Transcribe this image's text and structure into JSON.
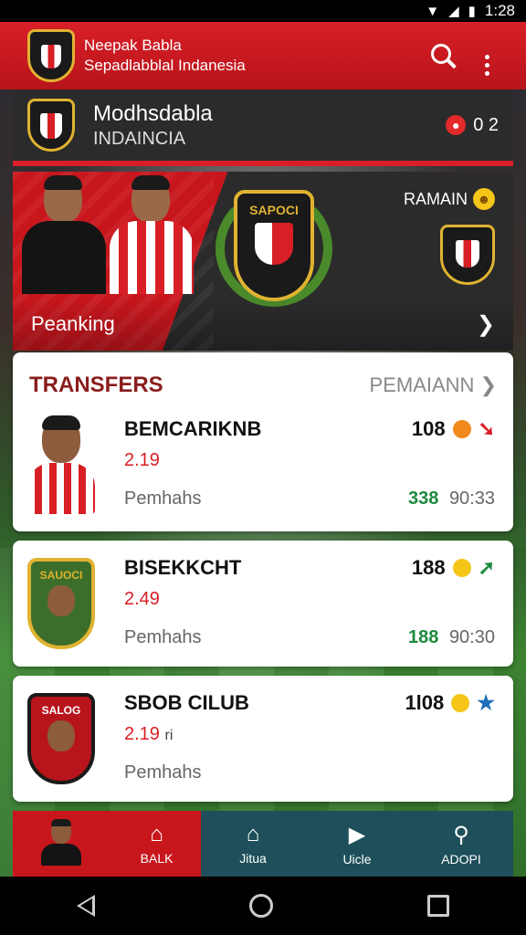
{
  "status_bar": {
    "time": "1:28",
    "icons": [
      "wifi-icon",
      "signal-icon",
      "battery-icon"
    ]
  },
  "app_bar": {
    "title": "Neepak Babla",
    "subtitle": "Sepadlabblal Indanesia",
    "icons": [
      "search-icon",
      "more-vert-icon"
    ]
  },
  "team": {
    "name": "Modhsdabla",
    "league": "INDAINCIA",
    "score": "0 2",
    "accent": "#d81f26"
  },
  "hero": {
    "crest_text": "SAPOCI",
    "right_label": "RAMAIN",
    "footer_label": "Peanking"
  },
  "transfers": {
    "title": "TRANSFERS",
    "more_label": "PEMAIANN",
    "rows": [
      {
        "name": "BEMCARIKNB",
        "number": "2.19",
        "sub": "Pemhahs",
        "value": "108",
        "green": "338",
        "time": "90:33",
        "trend": "down"
      },
      {
        "name": "BISEKKCHT",
        "number": "2.49",
        "sub": "Pemhahs",
        "value": "188",
        "green": "188",
        "time": "90:30",
        "trend": "up",
        "badge": "SAUOCI"
      },
      {
        "name": "SBOB CILUB",
        "number": "2.19",
        "number_suffix": "ri",
        "sub": "Pemhahs",
        "value": "1l08",
        "trend": "star",
        "badge": "SALOG"
      }
    ]
  },
  "bottom_nav": {
    "items": [
      {
        "label": "BALK",
        "icon": "home-icon"
      },
      {
        "label": "Jitua",
        "icon": "home-icon"
      },
      {
        "label": "Uicle",
        "icon": "video-icon"
      },
      {
        "label": "ADOPI",
        "icon": "profile-icon"
      }
    ]
  }
}
